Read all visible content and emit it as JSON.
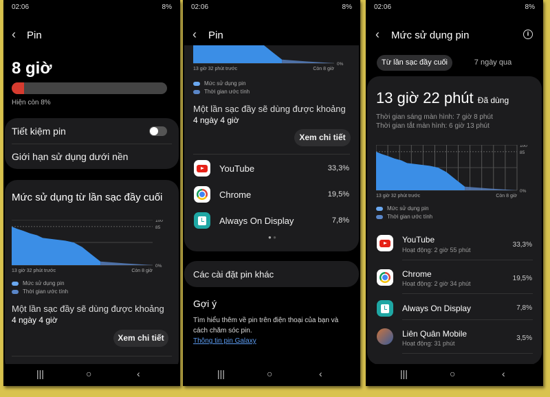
{
  "status_bar": {
    "time": "02:06",
    "battery": "8%"
  },
  "colors": {
    "background": "#d9c34f",
    "chart_fill": "#3b8ee6",
    "battery_low": "#d63b2f",
    "link": "#5b9bf0"
  },
  "chart_data": {
    "type": "area",
    "x_start_label": "13 giờ 32 phút trước",
    "x_end_label": "Còn 8 giờ",
    "y_ticks": [
      "100",
      "85",
      "0%"
    ],
    "ylim": [
      0,
      100
    ],
    "series": [
      {
        "name": "Mức sử dụng pin",
        "x": [
          0,
          0.04,
          0.08,
          0.13,
          0.18,
          0.22,
          0.3,
          0.38,
          0.44,
          0.5,
          0.56,
          0.63
        ],
        "y": [
          85,
          80,
          76,
          70,
          66,
          60,
          57,
          54,
          50,
          40,
          25,
          8
        ]
      },
      {
        "name": "Thời gian ước tính",
        "x": [
          0.63,
          0.8,
          1.0
        ],
        "y": [
          8,
          4,
          0
        ]
      }
    ],
    "legend": [
      "Mức sử dụng pin",
      "Thời gian ước tính"
    ]
  },
  "screen1": {
    "title": "Pin",
    "remaining_time": "8 giờ",
    "battery_level": 8,
    "remaining_text": "Hiện còn 8%",
    "power_saving": "Tiết kiệm pin",
    "power_saving_on": false,
    "background_limit": "Giới hạn sử dụng dưới nền",
    "usage_title": "Mức sử dụng từ lần sạc đầy cuối",
    "full_charge_text": "Một lần sạc đầy sẽ dùng được khoảng",
    "full_charge_value": "4 ngày 4 giờ",
    "details_button": "Xem chi tiết"
  },
  "screen2": {
    "title": "Pin",
    "full_charge_text": "Một lần sạc đầy sẽ dùng được khoảng",
    "full_charge_value": "4 ngày 4 giờ",
    "details_button": "Xem chi tiết",
    "apps": [
      {
        "name": "YouTube",
        "percent": "33,3%"
      },
      {
        "name": "Chrome",
        "percent": "19,5%"
      },
      {
        "name": "Always On Display",
        "percent": "7,8%"
      }
    ],
    "other_settings": "Các cài đặt pin khác",
    "suggestion_title": "Gợi ý",
    "suggestion_text_1": "Tìm hiểu thêm về pin trên điện thoại của bạn và",
    "suggestion_text_2": "cách chăm sóc pin.",
    "suggestion_link": "Thông tin pin Galaxy"
  },
  "screen3": {
    "title": "Mức sử dụng pin",
    "tabs": [
      "Từ lần sạc đầy cuối",
      "7 ngày qua"
    ],
    "used_time": "13 giờ 22 phút",
    "used_label": "Đã dùng",
    "screen_on": "Thời gian sáng màn hình: 7 giờ 8 phút",
    "screen_off": "Thời gian tắt màn hình: 6 giờ 13 phút",
    "apps": [
      {
        "name": "YouTube",
        "active": "Hoạt động: 2 giờ 55 phút",
        "percent": "33,3%"
      },
      {
        "name": "Chrome",
        "active": "Hoạt động: 2 giờ 34 phút",
        "percent": "19,5%"
      },
      {
        "name": "Always On Display",
        "active": "",
        "percent": "7,8%"
      },
      {
        "name": "Liên Quân Mobile",
        "active": "Hoạt động: 31 phút",
        "percent": "3,5%"
      }
    ]
  }
}
